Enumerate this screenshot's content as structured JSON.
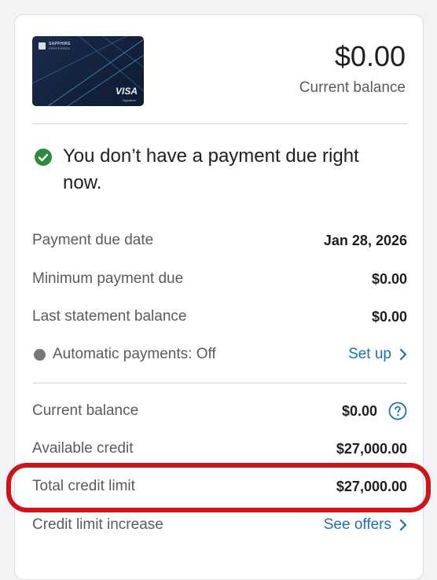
{
  "card_image": {
    "brand_line1": "SAPPHIRE",
    "brand_line2": "PREFERRED",
    "network": "VISA",
    "tier": "Signature"
  },
  "balance": {
    "amount": "$0.00",
    "label": "Current balance"
  },
  "status": {
    "icon": "check-circle-icon",
    "color": "#2e8b3d",
    "message": "You don’t have a payment due right now."
  },
  "payment_details": {
    "due_date_label": "Payment due date",
    "due_date_value": "Jan 28, 2026",
    "min_payment_label": "Minimum payment due",
    "min_payment_value": "$0.00",
    "last_statement_label": "Last statement balance",
    "last_statement_value": "$0.00",
    "autopay_label": "Automatic payments: Off",
    "autopay_link": "Set up"
  },
  "credit_details": {
    "current_balance_label": "Current balance",
    "current_balance_value": "$0.00",
    "available_credit_label": "Available credit",
    "available_credit_value": "$27,000.00",
    "total_limit_label": "Total credit limit",
    "total_limit_value": "$27,000.00",
    "limit_increase_label": "Credit limit increase",
    "limit_increase_link": "See offers"
  },
  "colors": {
    "link": "#1d6fb8",
    "highlight": "#d0121b",
    "check": "#2e8b3d"
  }
}
